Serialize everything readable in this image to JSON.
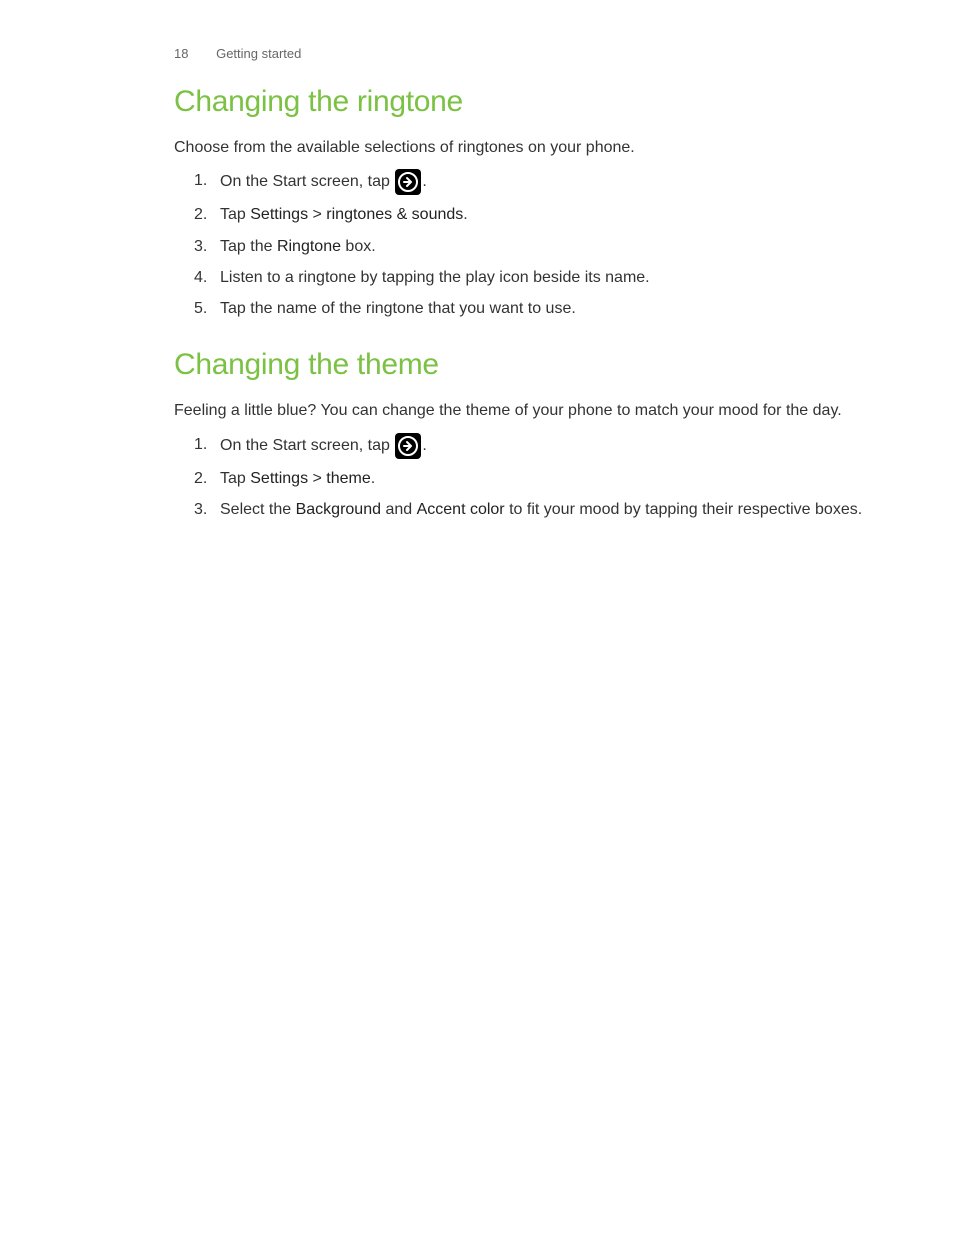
{
  "header": {
    "page_number": "18",
    "section": "Getting started"
  },
  "section1": {
    "heading": "Changing the ringtone",
    "intro": "Choose from the available selections of ringtones on your phone.",
    "steps": {
      "s1_pre": "On the Start screen, tap ",
      "s1_post": ".",
      "s2_pre": "Tap ",
      "s2_b1": "Settings",
      "s2_mid": " > ",
      "s2_b2": "ringtones & sounds",
      "s2_post": ".",
      "s3_pre": "Tap the ",
      "s3_b1": "Ringtone",
      "s3_post": " box.",
      "s4": "Listen to a ringtone by tapping the play icon beside its name.",
      "s5": "Tap the name of the ringtone that you want to use."
    }
  },
  "section2": {
    "heading": "Changing the theme",
    "intro": "Feeling a little blue? You can change the theme of your phone to match your mood for the day.",
    "steps": {
      "s1_pre": "On the Start screen, tap ",
      "s1_post": ".",
      "s2_pre": "Tap ",
      "s2_b1": "Settings",
      "s2_mid": " > ",
      "s2_b2": "theme",
      "s2_post": ".",
      "s3_pre": "Select the ",
      "s3_b1": "Background",
      "s3_mid": " and ",
      "s3_b2": "Accent color",
      "s3_post": " to fit your mood by tapping their respective boxes."
    }
  }
}
